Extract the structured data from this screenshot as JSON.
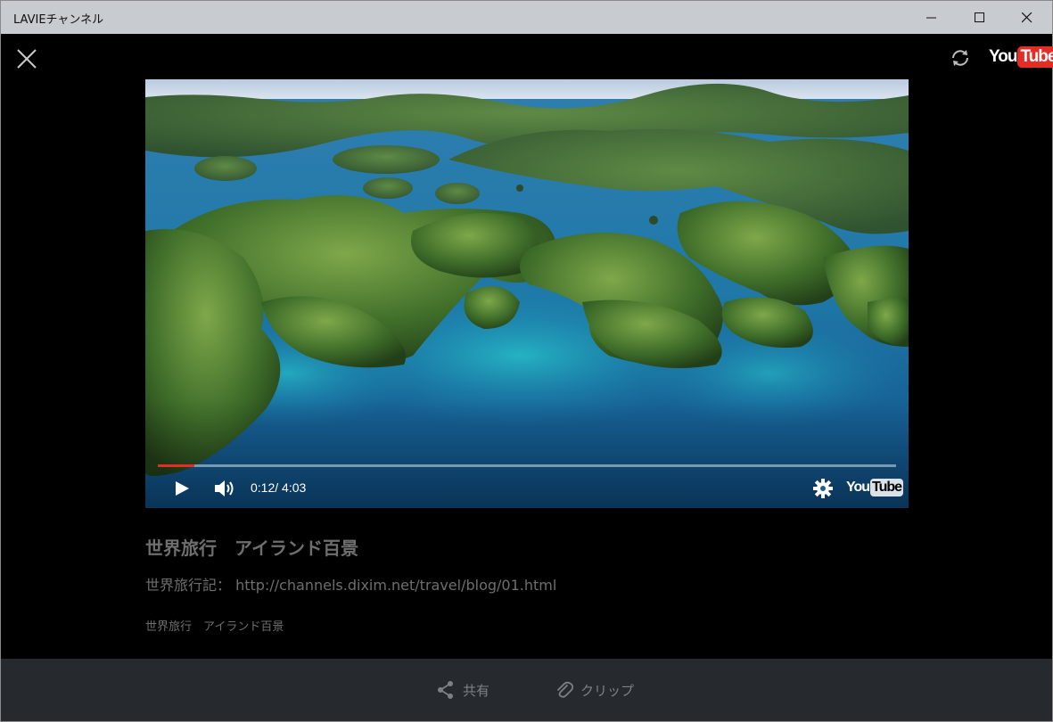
{
  "window": {
    "title": "LAVIEチャンネル"
  },
  "youtube_logo": {
    "you": "You",
    "tube": "Tube"
  },
  "player": {
    "current_time": "0:12/",
    "duration": "4:03",
    "progress_fraction": 0.05
  },
  "video": {
    "title": "世界旅行　アイランド百景",
    "description": "世界旅行記： http://channels.dixim.net/travel/blog/01.html",
    "tags": "世界旅行　アイランド百景"
  },
  "actions": {
    "share_label": "共有",
    "clip_label": "クリップ"
  },
  "colors": {
    "accent_red": "#e52d27",
    "titlebar": "#c8cbd0",
    "bottombar": "#26292d"
  }
}
